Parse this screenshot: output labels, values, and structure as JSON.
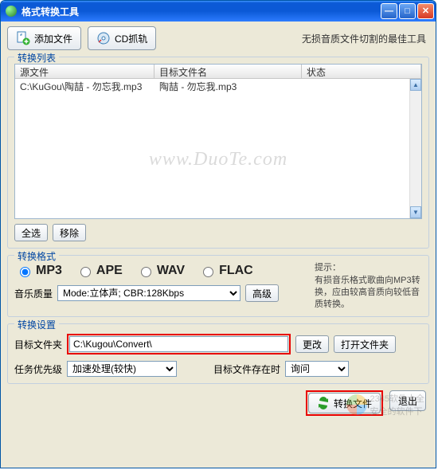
{
  "window": {
    "title": "格式转换工具"
  },
  "toolbar": {
    "add_file_label": "添加文件",
    "cd_grab_label": "CD抓轨",
    "slogan": "无损音质文件切割的最佳工具"
  },
  "list_group": {
    "legend": "转换列表",
    "headers": {
      "source": "源文件",
      "target": "目标文件名",
      "status": "状态"
    },
    "rows": [
      {
        "source": "C:\\KuGou\\陶喆 - 勿忘我.mp3",
        "target": "陶喆 - 勿忘我.mp3",
        "status": ""
      }
    ],
    "select_all_label": "全选",
    "remove_label": "移除"
  },
  "format_group": {
    "legend": "转换格式",
    "options": [
      "MP3",
      "APE",
      "WAV",
      "FLAC"
    ],
    "selected": "MP3",
    "hint_title": "提示：",
    "hint_body": "有损音乐格式歌曲向MP3转换，应由较高音质向较低音质转换。",
    "quality_label": "音乐质量",
    "quality_value": "Mode:立体声; CBR:128Kbps",
    "advanced_label": "高级"
  },
  "settings_group": {
    "legend": "转换设置",
    "target_folder_label": "目标文件夹",
    "target_folder_value": "C:\\Kugou\\Convert\\",
    "change_label": "更改",
    "open_folder_label": "打开文件夹",
    "priority_label": "任务优先级",
    "priority_value": "加速处理(较快)",
    "exists_label": "目标文件存在时",
    "exists_value": "询问"
  },
  "bottom": {
    "convert_label": "转换文件",
    "exit_label": "退出"
  },
  "watermark_site": "www.DuoTe.com",
  "bg_watermark_1": "2345软件大全",
  "bg_watermark_2": "安全的软件下"
}
